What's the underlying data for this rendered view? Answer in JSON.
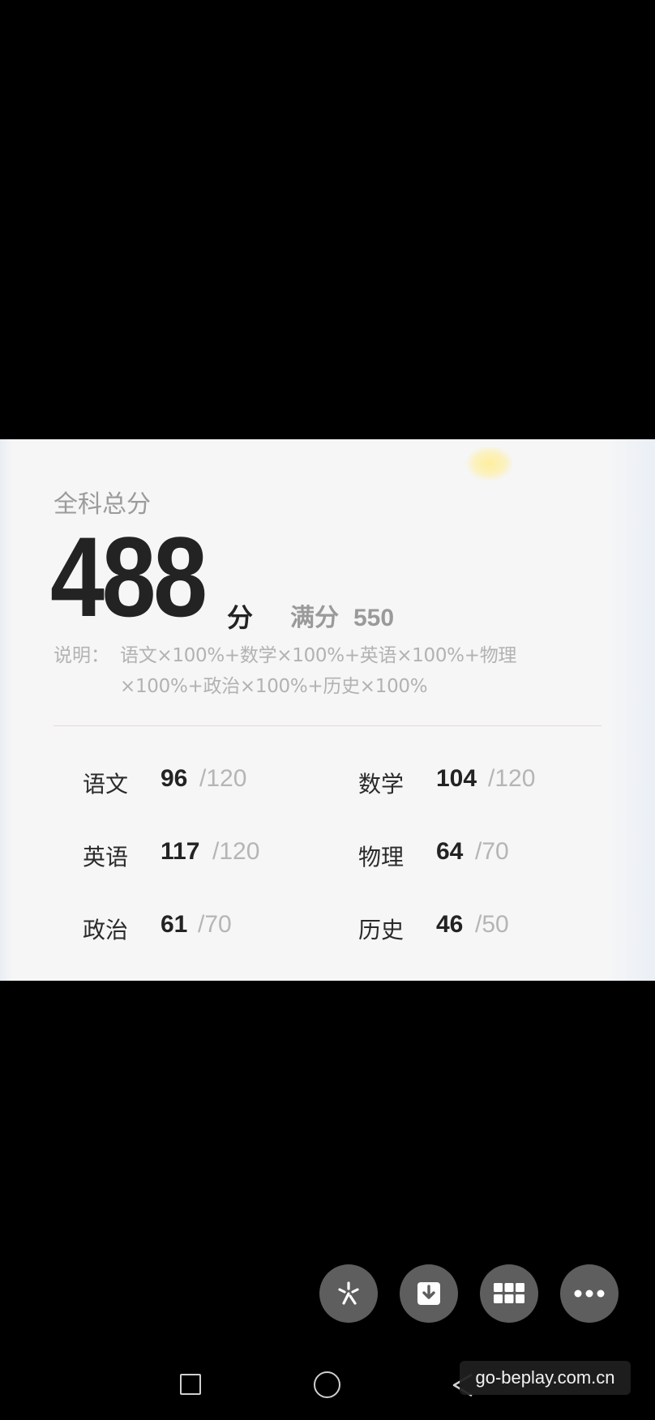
{
  "score_card": {
    "total_label": "全科总分",
    "total_score": "488",
    "total_unit": "分",
    "full_label": "满分",
    "full_value": "550",
    "note_label": "说明：",
    "note_line_1": "语文×100%+数学×100%+英语×100%+物理",
    "note_line_2": "×100%+政治×100%+历史×100%",
    "subjects": [
      {
        "name": "语文",
        "score": "96",
        "full": "/120"
      },
      {
        "name": "数学",
        "score": "104",
        "full": "/120"
      },
      {
        "name": "英语",
        "score": "117",
        "full": "/120"
      },
      {
        "name": "物理",
        "score": "64",
        "full": "/70"
      },
      {
        "name": "政治",
        "score": "61",
        "full": "/70"
      },
      {
        "name": "历史",
        "score": "46",
        "full": "/50"
      }
    ]
  },
  "toolbar": {
    "buttons": [
      {
        "icon": "sparkle-icon"
      },
      {
        "icon": "download-icon"
      },
      {
        "icon": "grid-icon"
      },
      {
        "icon": "more-icon"
      }
    ]
  },
  "nav_bar": {
    "icons": [
      "recent-apps-icon",
      "home-icon",
      "back-icon"
    ]
  },
  "watermark": {
    "text": "go-beplay.com.cn"
  },
  "colors": {
    "card_background": "#f6f6f7",
    "score_text": "#232323",
    "muted_text": "#9b9b9b",
    "button_background": "#5e5e5e"
  }
}
